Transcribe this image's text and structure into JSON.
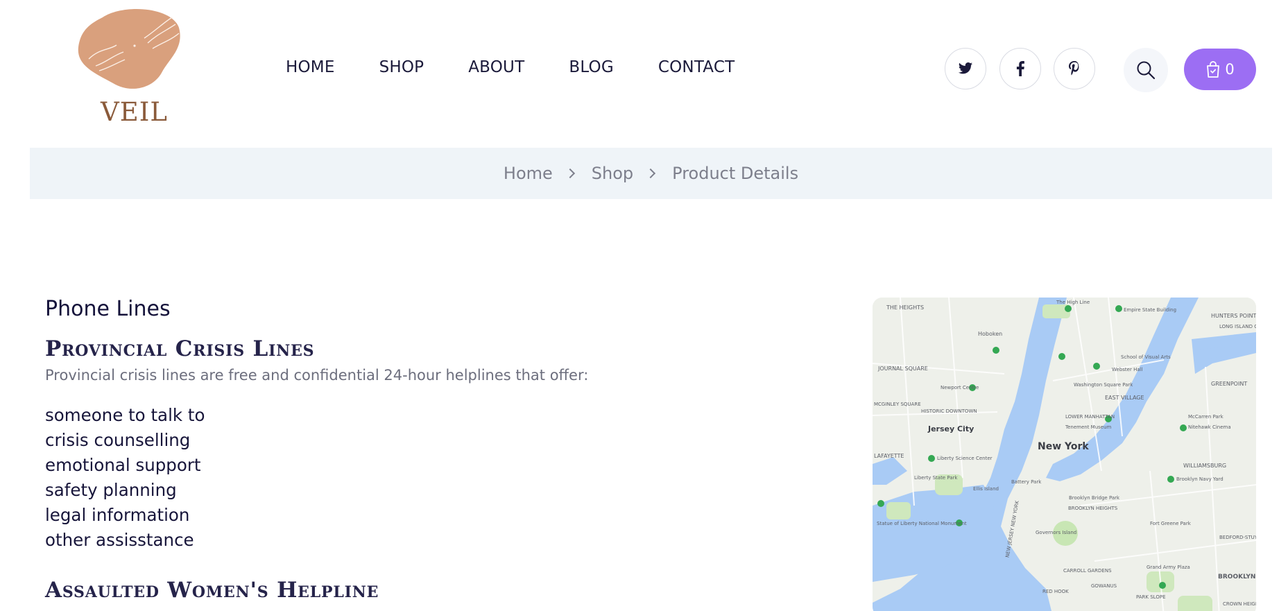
{
  "brand": {
    "name": "VEIL"
  },
  "nav": {
    "items": [
      {
        "label": "HOME"
      },
      {
        "label": "SHOP"
      },
      {
        "label": "ABOUT"
      },
      {
        "label": "BLOG"
      },
      {
        "label": "CONTACT"
      }
    ]
  },
  "header_actions": {
    "socials": [
      "twitter-icon",
      "facebook-icon",
      "pinterest-icon"
    ],
    "search_icon": "search-icon",
    "cart": {
      "icon": "shopping-bag-icon",
      "count": "0"
    }
  },
  "breadcrumb": {
    "items": [
      {
        "label": "Home"
      },
      {
        "label": "Shop"
      },
      {
        "label": "Product Details"
      }
    ]
  },
  "content": {
    "title": "Phone Lines",
    "section1": {
      "heading": "Provincial Crisis Lines",
      "intro": "Provincial crisis lines are free and confidential 24-hour helplines that offer:",
      "list": [
        "someone to talk to",
        "crisis counselling",
        "emotional support",
        "safety planning",
        "legal information",
        "other assisstance"
      ]
    },
    "section2": {
      "heading": "Assaulted Women's Helpline"
    }
  },
  "map": {
    "labels": {
      "new_york": "New York",
      "jersey_city": "Jersey City",
      "the_heights": "THE HEIGHTS",
      "hoboken": "Hoboken",
      "journal_square": "JOURNAL SQUARE",
      "historic_downtown": "HISTORIC DOWNTOWN",
      "mcginley_square": "MCGINLEY SQUARE",
      "lafayette": "LAFAYETTE",
      "east_village": "EAST VILLAGE",
      "lower_manhattan": "LOWER MANHATTAN",
      "greenpoint": "GREENPOINT",
      "hunters_point": "HUNTERS POINT",
      "williamsburg": "WILLIAMSBURG",
      "brooklyn": "BROOKLYN",
      "red_hook": "RED HOOK",
      "park_slope": "PARK SLOPE",
      "crown_heights": "CROWN HEIGH",
      "bedford_stuy": "BEDFORD-STUY",
      "gowanus": "GOWANUS",
      "carroll_gardens": "CARROLL GARDENS",
      "brooklyn_heights": "BROOKLYN HEIGHTS",
      "fort_greene_park": "Fort Greene Park",
      "liberty_state_park": "Liberty State Park",
      "statue_of_liberty": "Statue of Liberty National Monument",
      "empire_state": "Empire State Building",
      "washington_square": "Washington Square Park",
      "webster_hall": "Webster Hall",
      "school_visual_arts": "School of Visual Arts",
      "liberty_science": "Liberty Science Center",
      "newport_centre": "Newport Centre",
      "battery_park": "Battery Park",
      "ellis_island": "Ellis Island",
      "governors_island": "Governors Island",
      "high_line": "The High Line",
      "brooklyn_navy_yard": "Brooklyn Navy Yard",
      "mccarren_park": "McCarren Park",
      "nitehawk": "Nitehawk Cinema",
      "tenement_museum": "Tenement Museum",
      "brooklyn_bridge_park": "Brooklyn Bridge Park",
      "grand_army_plaza": "Grand Army Plaza",
      "new_jersey_ny": "NEW JERSEY NEW YORK",
      "long_island_city": "LONG ISLAND CITY"
    }
  }
}
